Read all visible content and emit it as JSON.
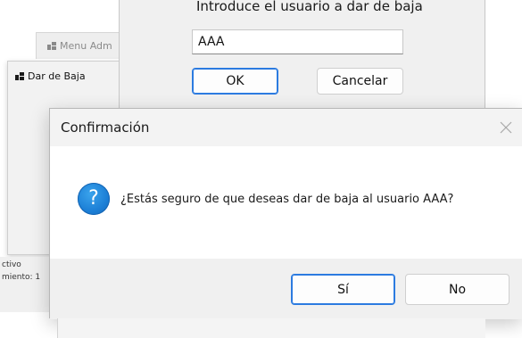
{
  "background": {
    "admin_window_title": "Menu Adm",
    "baja_window_title": "Dar de Baja",
    "left_fragment_line1": "ctivo",
    "left_fragment_line2": "miento: 1"
  },
  "input_dialog": {
    "prompt": "Introduce el usuario a dar de baja",
    "input_value": "AAA",
    "ok_label": "OK",
    "cancel_label": "Cancelar"
  },
  "confirm_dialog": {
    "title": "Confirmación",
    "message": "¿Estás seguro de que deseas dar de baja al usuario AAA?",
    "icon_glyph": "?",
    "yes_label": "Sí",
    "no_label": "No"
  },
  "icons": {
    "app": "app-window-icon",
    "question": "question-icon",
    "close": "close-icon"
  },
  "colors": {
    "accent": "#2c7be0",
    "question_icon": "#1c7fd6",
    "dialog_footer": "#f0f0f0"
  }
}
